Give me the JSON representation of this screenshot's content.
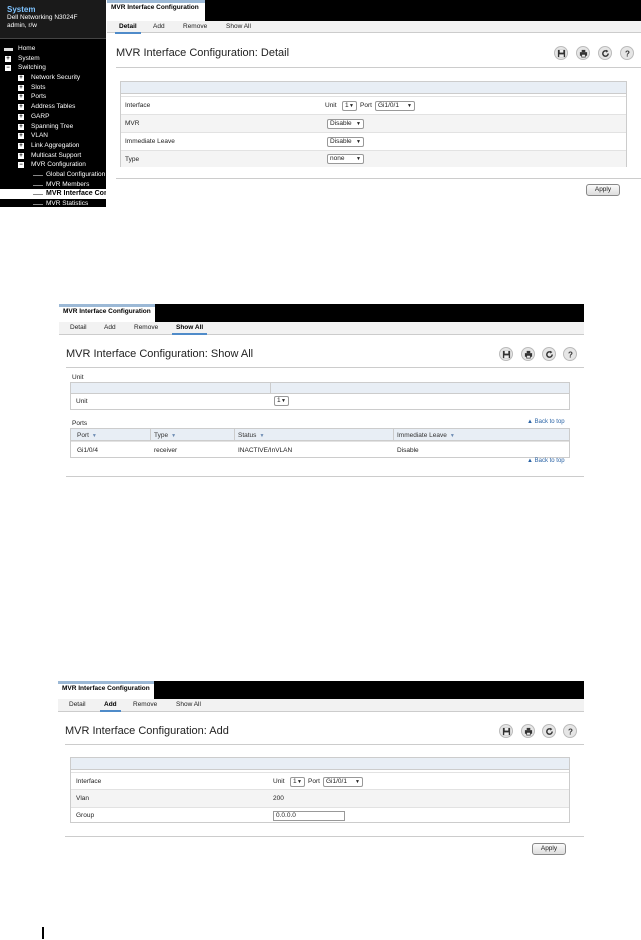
{
  "sidebar": {
    "system": "System",
    "model": "Dell Networking N3024F",
    "user": "admin, r/w",
    "items": [
      {
        "label": "Home"
      },
      {
        "label": "System"
      },
      {
        "label": "Switching"
      },
      {
        "label": "Network Security"
      },
      {
        "label": "Slots"
      },
      {
        "label": "Ports"
      },
      {
        "label": "Address Tables"
      },
      {
        "label": "GARP"
      },
      {
        "label": "Spanning Tree"
      },
      {
        "label": "VLAN"
      },
      {
        "label": "Link Aggregation"
      },
      {
        "label": "Multicast Support"
      },
      {
        "label": "MVR Configuration"
      },
      {
        "label": "Global Configuration"
      },
      {
        "label": "MVR Members"
      },
      {
        "label": "MVR Interface Configuration"
      },
      {
        "label": "MVR Statistics"
      }
    ]
  },
  "icons": {
    "save": "save-icon",
    "print": "print-icon",
    "refresh": "refresh-icon",
    "help": "help-icon"
  },
  "detail": {
    "tab_title": "MVR Interface Configuration",
    "nav": [
      "Detail",
      "Add",
      "Remove",
      "Show All"
    ],
    "active_nav": "Detail",
    "page_title": "MVR Interface Configuration: Detail",
    "rows": {
      "interface_label": "Interface",
      "unit_label": "Unit",
      "unit_value": "1",
      "port_label": "Port",
      "port_value": "Gi1/0/1",
      "mvr_label": "MVR",
      "mvr_value": "Disable",
      "immediate_leave_label": "Immediate Leave",
      "immediate_leave_value": "Disable",
      "type_label": "Type",
      "type_value": "none"
    },
    "apply": "Apply"
  },
  "showall": {
    "tab_title": "MVR Interface Configuration",
    "nav": [
      "Detail",
      "Add",
      "Remove",
      "Show All"
    ],
    "active_nav": "Show All",
    "page_title": "MVR Interface Configuration: Show All",
    "unit_section": "Unit",
    "unit_label": "Unit",
    "unit_value": "1",
    "ports_section": "Ports",
    "back_to_top": "Back to top",
    "columns": [
      "Port",
      "Type",
      "Status",
      "Immediate Leave"
    ],
    "rows": [
      [
        "Gi1/0/4",
        "receiver",
        "INACTIVE/InVLAN",
        "Disable"
      ]
    ]
  },
  "add": {
    "tab_title": "MVR Interface Configuration",
    "nav": [
      "Detail",
      "Add",
      "Remove",
      "Show All"
    ],
    "active_nav": "Add",
    "page_title": "MVR Interface Configuration: Add",
    "interface_label": "Interface",
    "unit_label": "Unit",
    "unit_value": "1",
    "port_label": "Port",
    "port_value": "Gi1/0/1",
    "vlan_label": "Vlan",
    "vlan_value": "200",
    "group_label": "Group",
    "group_value": "0.0.0.0",
    "apply": "Apply"
  }
}
